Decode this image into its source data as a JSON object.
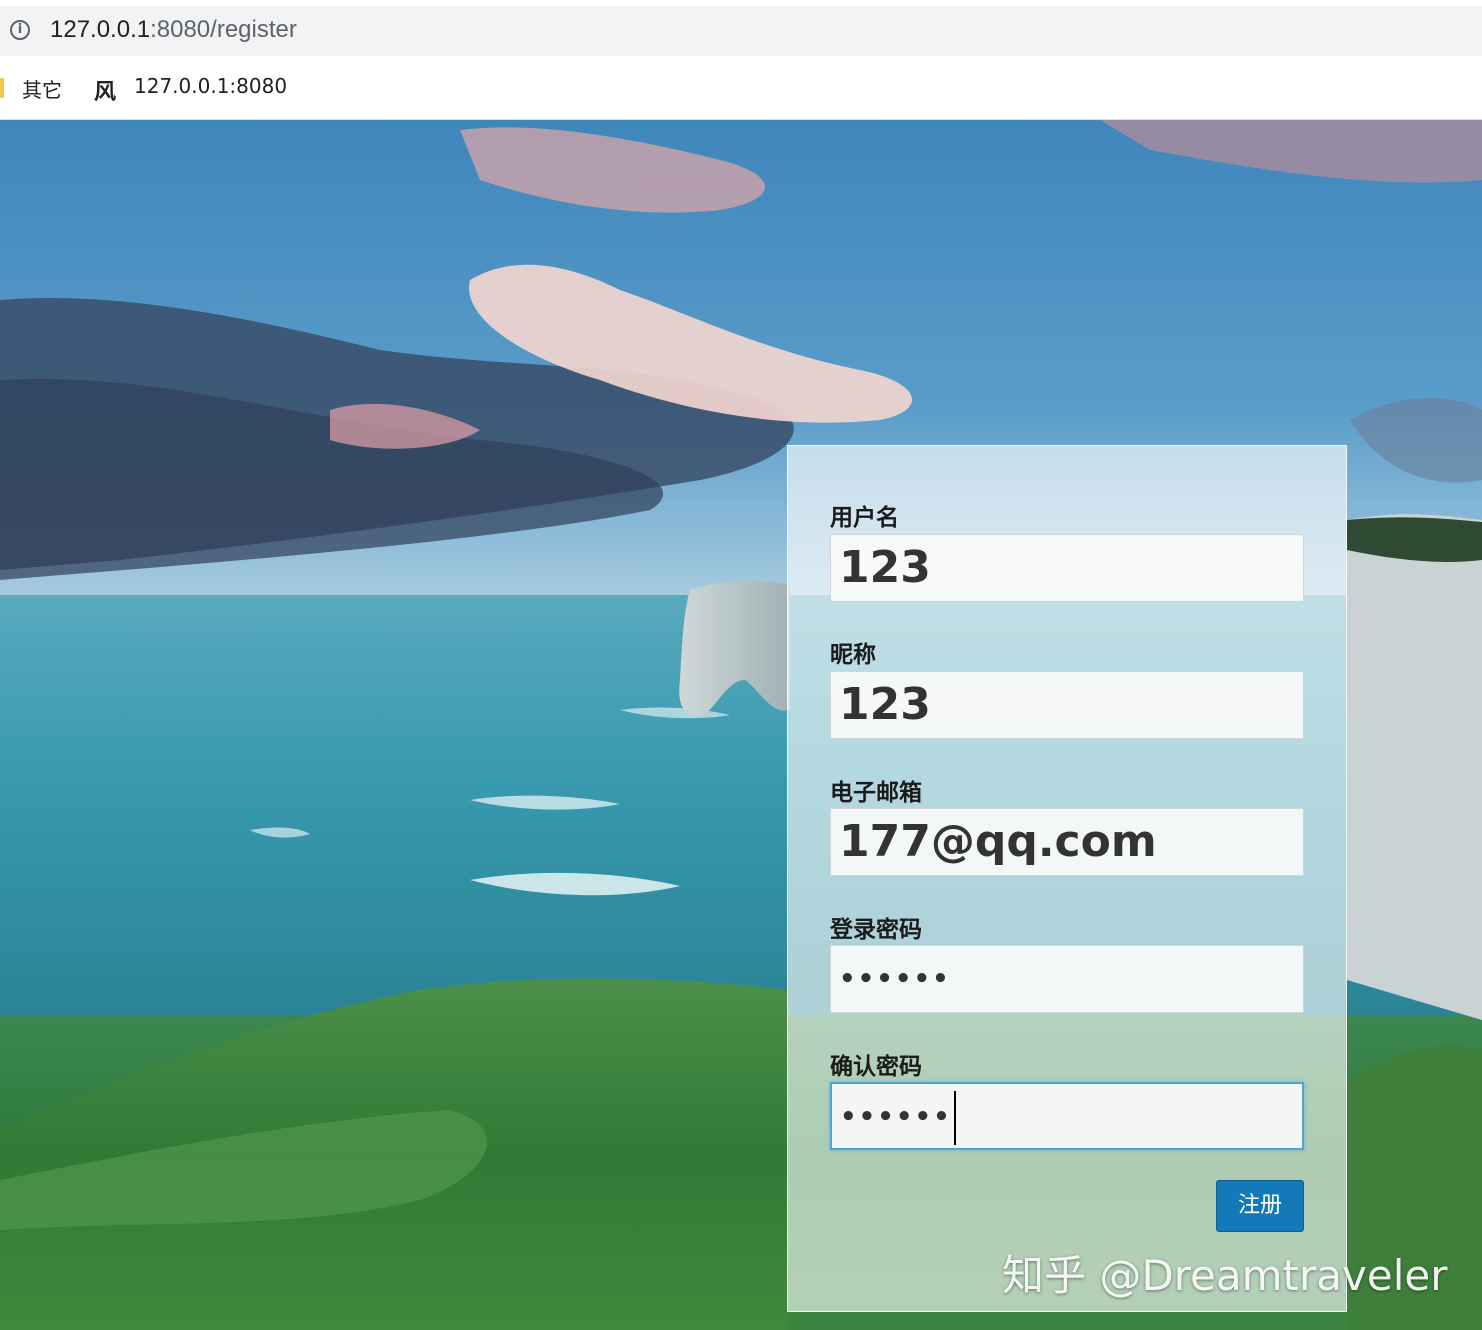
{
  "browser": {
    "url_host": "127.0.0.1",
    "url_path": ":8080/register",
    "bookmarks": [
      {
        "label": "其它"
      },
      {
        "label": "127.0.0.1:8080"
      }
    ]
  },
  "form": {
    "username": {
      "label": "用户名",
      "value": "123"
    },
    "nickname": {
      "label": "昵称",
      "value": "123"
    },
    "email": {
      "label": "电子邮箱",
      "value": "177@qq.com"
    },
    "password": {
      "label": "登录密码",
      "value": "••••••"
    },
    "confirm_password": {
      "label": "确认密码",
      "value": "••••••"
    },
    "submit_label": "注册"
  },
  "watermark": "知乎 @Dreamtraveler",
  "colors": {
    "button": "#1479b8",
    "focus_border": "#4da3d6"
  },
  "icons": {
    "address": "info-icon",
    "bookmark_folder": "folder-icon",
    "bookmark_site": "site-favicon-icon"
  }
}
